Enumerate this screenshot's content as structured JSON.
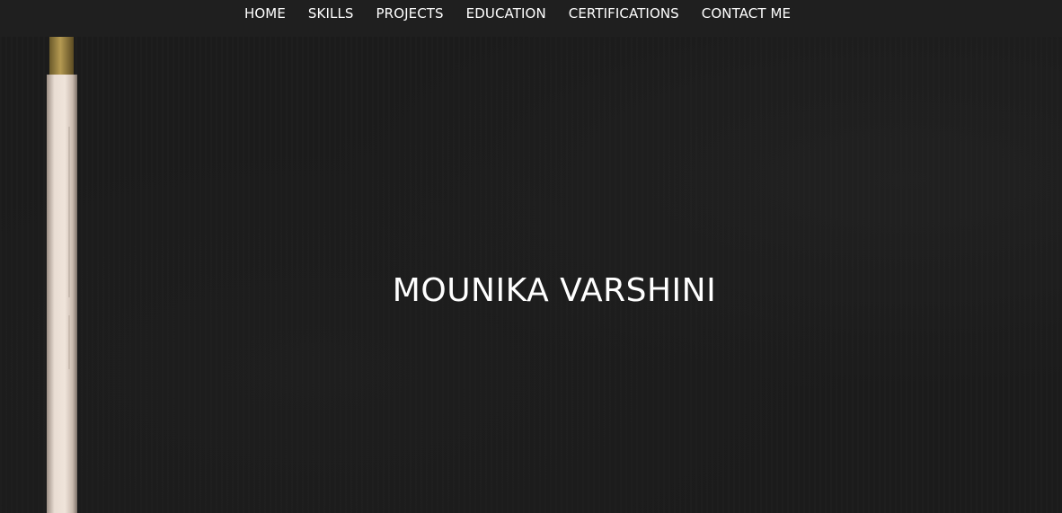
{
  "navbar": {
    "items": [
      {
        "label": "HOME"
      },
      {
        "label": "SKILLS"
      },
      {
        "label": "PROJECTS"
      },
      {
        "label": "EDUCATION"
      },
      {
        "label": "CERTIFICATIONS"
      },
      {
        "label": "CONTACT ME"
      }
    ]
  },
  "hero": {
    "title": "MOUNIKA VARSHINI",
    "background_image": "pencil-on-dark-surface"
  },
  "colors": {
    "background": "#1b1b1b",
    "navbar": "#1f1f1f",
    "text": "#ffffff"
  }
}
